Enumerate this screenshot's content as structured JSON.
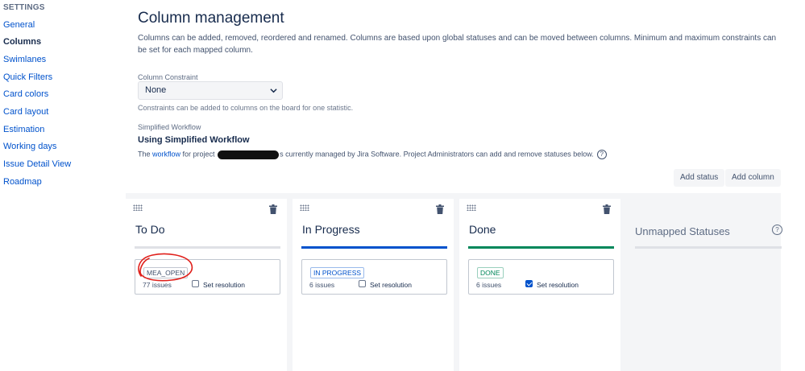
{
  "sidebar": {
    "heading": "SETTINGS",
    "items": [
      {
        "label": "General"
      },
      {
        "label": "Columns"
      },
      {
        "label": "Swimlanes"
      },
      {
        "label": "Quick Filters"
      },
      {
        "label": "Card colors"
      },
      {
        "label": "Card layout"
      },
      {
        "label": "Estimation"
      },
      {
        "label": "Working days"
      },
      {
        "label": "Issue Detail View"
      },
      {
        "label": "Roadmap"
      }
    ],
    "active": "Columns"
  },
  "header": {
    "title": "Column management",
    "description": "Columns can be added, removed, reordered and renamed. Columns are based upon global statuses and can be moved between columns. Minimum and maximum constraints can be set for each mapped column."
  },
  "constraint": {
    "label": "Column Constraint",
    "value": "None",
    "hint": "Constraints can be added to columns on the board for one statistic."
  },
  "workflow": {
    "label": "Simplified Workflow",
    "title": "Using Simplified Workflow",
    "text_before": "The ",
    "link": "workflow",
    "text_mid": " for project ",
    "text_after": "s currently managed by Jira Software. Project Administrators can add and remove statuses below.",
    "help_glyph": "?"
  },
  "actions": {
    "add_status": "Add status",
    "add_column": "Add column"
  },
  "columns": [
    {
      "name": "To Do",
      "bar_color": "#dfe1e6",
      "status": "MEA_OPEN",
      "issues": "77 issues",
      "set_resolution": "Set resolution",
      "resolution_checked": false,
      "status_color": "#42526e"
    },
    {
      "name": "In Progress",
      "bar_color": "#0052cc",
      "status": "IN PROGRESS",
      "issues": "6 issues",
      "set_resolution": "Set resolution",
      "resolution_checked": false,
      "status_color": "#0052cc"
    },
    {
      "name": "Done",
      "bar_color": "#00875a",
      "status": "DONE",
      "issues": "6 issues",
      "set_resolution": "Set resolution",
      "resolution_checked": true,
      "status_color": "#00875a"
    }
  ],
  "unmapped": {
    "title": "Unmapped Statuses",
    "help_glyph": "?"
  },
  "colors": {
    "link": "#0052cc",
    "annotation": "#e0201b"
  }
}
